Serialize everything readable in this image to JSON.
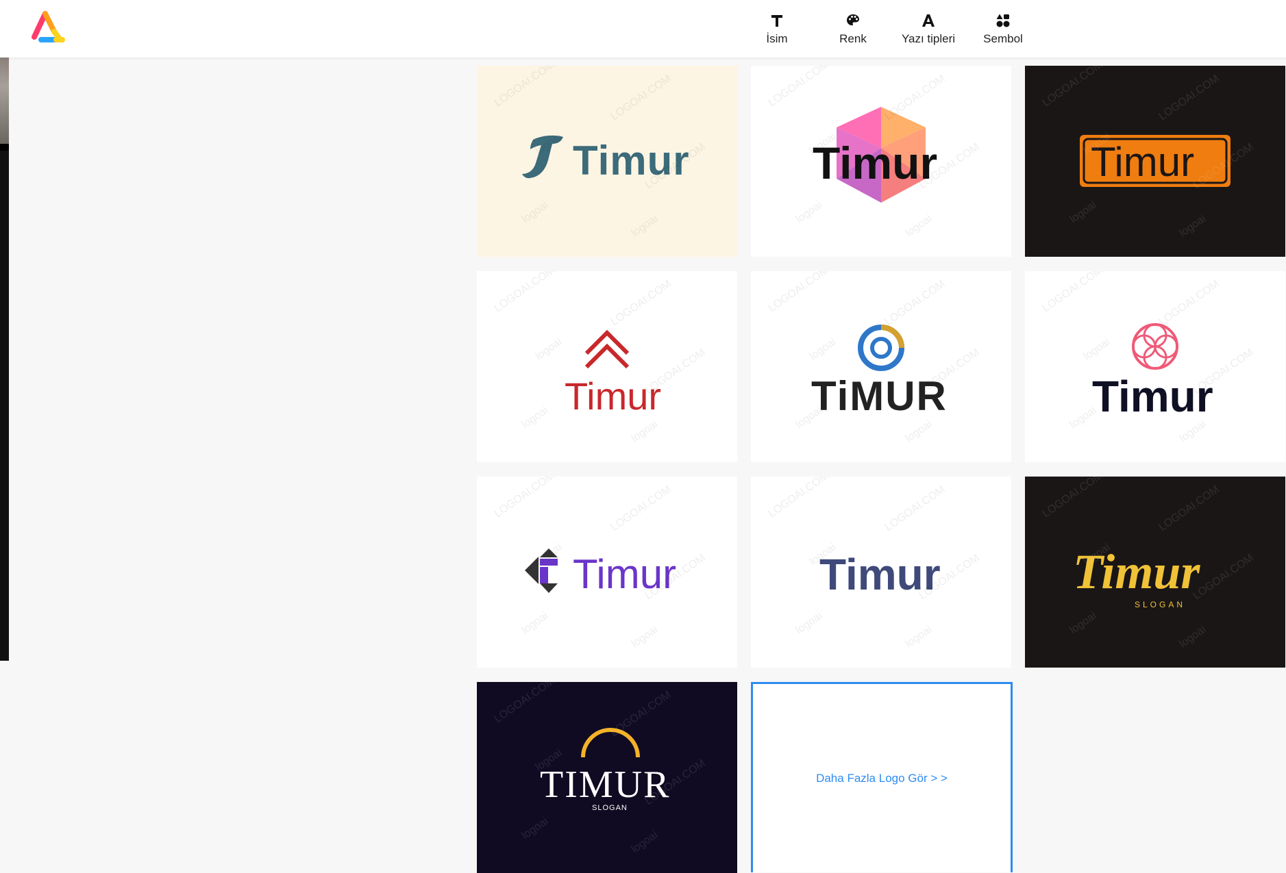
{
  "nav": [
    {
      "label": "İsim",
      "icon": "text-T-icon"
    },
    {
      "label": "Renk",
      "icon": "palette-icon"
    },
    {
      "label": "Yazı tipleri",
      "icon": "font-A-icon"
    },
    {
      "label": "Sembol",
      "icon": "shapes-icon"
    }
  ],
  "logos": [
    {
      "name": "Timur",
      "bg": "#fdf5e4",
      "style": "swoosh-T"
    },
    {
      "name": "Timur",
      "bg": "#ffffff",
      "style": "hexagon"
    },
    {
      "name": "Timur",
      "bg": "#1a1616",
      "style": "orange-badge"
    },
    {
      "name": "Timur",
      "bg": "#ffffff",
      "style": "red-chevron"
    },
    {
      "name": "TiMUR",
      "bg": "#ffffff",
      "style": "blue-gold-circle"
    },
    {
      "name": "Timur",
      "bg": "#ffffff",
      "style": "pink-flower"
    },
    {
      "name": "Timur",
      "bg": "#ffffff",
      "style": "purple-arrows"
    },
    {
      "name": "Timur",
      "bg": "#ffffff",
      "style": "gradient-text"
    },
    {
      "name": "Timur",
      "slogan": "SLOGAN",
      "bg": "#1a1616",
      "style": "gold-italic"
    },
    {
      "name": "TIMUR",
      "slogan": "SLOGAN",
      "bg": "#100b22",
      "style": "arc-serif"
    }
  ],
  "more_link": "Daha Fazla Logo Gör > >",
  "watermark": {
    "domain": "LOGOAI.COM",
    "brand": "logoai"
  }
}
